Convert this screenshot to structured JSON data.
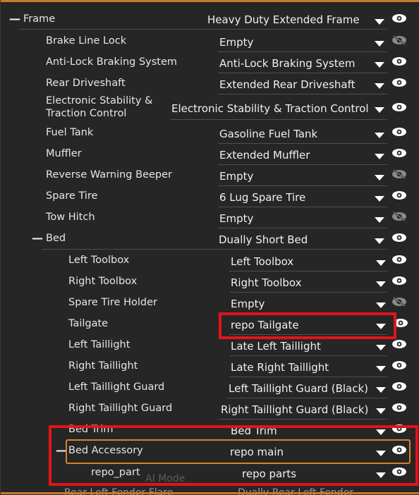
{
  "colors": {
    "highlight_red": "#e0141b",
    "highlight_orange": "#d9822b",
    "accent_bar": "#c77a2c"
  },
  "rows": [
    {
      "label": "Frame",
      "value": "Heavy Duty Extended Frame",
      "visible": true,
      "collapse": "—"
    },
    {
      "label": "Brake Line Lock",
      "value": "Empty",
      "visible": false
    },
    {
      "label": "Anti-Lock Braking System",
      "value": "Anti-Lock Braking System",
      "visible": true
    },
    {
      "label": "Rear Driveshaft",
      "value": "Extended Rear Driveshaft",
      "visible": true
    },
    {
      "label": "Electronic Stability & Traction Control",
      "value": "Electronic Stability & Traction Control",
      "visible": true
    },
    {
      "label": "Fuel Tank",
      "value": "Gasoline Fuel Tank",
      "visible": true
    },
    {
      "label": "Muffler",
      "value": "Extended Muffler",
      "visible": true
    },
    {
      "label": "Reverse Warning Beeper",
      "value": "Empty",
      "visible": false
    },
    {
      "label": "Spare Tire",
      "value": "6 Lug Spare Tire",
      "visible": true
    },
    {
      "label": "Tow Hitch",
      "value": "Empty",
      "visible": false
    },
    {
      "label": "Bed",
      "value": "Dually Short Bed",
      "visible": true,
      "collapse": "—"
    },
    {
      "label": "Left Toolbox",
      "value": "Left Toolbox",
      "visible": true
    },
    {
      "label": "Right Toolbox",
      "value": "Right Toolbox",
      "visible": true
    },
    {
      "label": "Spare Tire Holder",
      "value": "Empty",
      "visible": false
    },
    {
      "label": "Tailgate",
      "value": "repo Tailgate",
      "visible": true
    },
    {
      "label": "Left Taillight",
      "value": "Late Left Taillight",
      "visible": true
    },
    {
      "label": "Right Taillight",
      "value": "Late Right Taillight",
      "visible": true
    },
    {
      "label": "Left Taillight Guard",
      "value": "Left Taillight Guard (Black)",
      "visible": true
    },
    {
      "label": "Right Taillight Guard",
      "value": "Right Taillight Guard (Black)",
      "visible": true
    },
    {
      "label": "Bed Trim",
      "value": "Bed Trim",
      "visible": true
    },
    {
      "label": "Bed Accessory",
      "value": "repo main",
      "visible": true,
      "collapse": "—"
    },
    {
      "label": "repo_part",
      "value": "repo parts",
      "visible": true
    }
  ],
  "ghost": {
    "ai_mode": "AI Mode",
    "bottom_label": "Rear Left Fender Flare",
    "bottom_value": "Dually Rear Left Fender"
  }
}
